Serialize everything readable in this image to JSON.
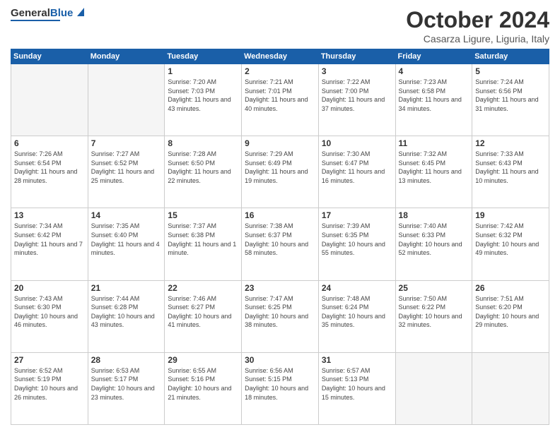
{
  "header": {
    "logo_general": "General",
    "logo_blue": "Blue",
    "month_title": "October 2024",
    "location": "Casarza Ligure, Liguria, Italy"
  },
  "days_of_week": [
    "Sunday",
    "Monday",
    "Tuesday",
    "Wednesday",
    "Thursday",
    "Friday",
    "Saturday"
  ],
  "weeks": [
    [
      {
        "day": "",
        "info": ""
      },
      {
        "day": "",
        "info": ""
      },
      {
        "day": "1",
        "info": "Sunrise: 7:20 AM\nSunset: 7:03 PM\nDaylight: 11 hours and 43 minutes."
      },
      {
        "day": "2",
        "info": "Sunrise: 7:21 AM\nSunset: 7:01 PM\nDaylight: 11 hours and 40 minutes."
      },
      {
        "day": "3",
        "info": "Sunrise: 7:22 AM\nSunset: 7:00 PM\nDaylight: 11 hours and 37 minutes."
      },
      {
        "day": "4",
        "info": "Sunrise: 7:23 AM\nSunset: 6:58 PM\nDaylight: 11 hours and 34 minutes."
      },
      {
        "day": "5",
        "info": "Sunrise: 7:24 AM\nSunset: 6:56 PM\nDaylight: 11 hours and 31 minutes."
      }
    ],
    [
      {
        "day": "6",
        "info": "Sunrise: 7:26 AM\nSunset: 6:54 PM\nDaylight: 11 hours and 28 minutes."
      },
      {
        "day": "7",
        "info": "Sunrise: 7:27 AM\nSunset: 6:52 PM\nDaylight: 11 hours and 25 minutes."
      },
      {
        "day": "8",
        "info": "Sunrise: 7:28 AM\nSunset: 6:50 PM\nDaylight: 11 hours and 22 minutes."
      },
      {
        "day": "9",
        "info": "Sunrise: 7:29 AM\nSunset: 6:49 PM\nDaylight: 11 hours and 19 minutes."
      },
      {
        "day": "10",
        "info": "Sunrise: 7:30 AM\nSunset: 6:47 PM\nDaylight: 11 hours and 16 minutes."
      },
      {
        "day": "11",
        "info": "Sunrise: 7:32 AM\nSunset: 6:45 PM\nDaylight: 11 hours and 13 minutes."
      },
      {
        "day": "12",
        "info": "Sunrise: 7:33 AM\nSunset: 6:43 PM\nDaylight: 11 hours and 10 minutes."
      }
    ],
    [
      {
        "day": "13",
        "info": "Sunrise: 7:34 AM\nSunset: 6:42 PM\nDaylight: 11 hours and 7 minutes."
      },
      {
        "day": "14",
        "info": "Sunrise: 7:35 AM\nSunset: 6:40 PM\nDaylight: 11 hours and 4 minutes."
      },
      {
        "day": "15",
        "info": "Sunrise: 7:37 AM\nSunset: 6:38 PM\nDaylight: 11 hours and 1 minute."
      },
      {
        "day": "16",
        "info": "Sunrise: 7:38 AM\nSunset: 6:37 PM\nDaylight: 10 hours and 58 minutes."
      },
      {
        "day": "17",
        "info": "Sunrise: 7:39 AM\nSunset: 6:35 PM\nDaylight: 10 hours and 55 minutes."
      },
      {
        "day": "18",
        "info": "Sunrise: 7:40 AM\nSunset: 6:33 PM\nDaylight: 10 hours and 52 minutes."
      },
      {
        "day": "19",
        "info": "Sunrise: 7:42 AM\nSunset: 6:32 PM\nDaylight: 10 hours and 49 minutes."
      }
    ],
    [
      {
        "day": "20",
        "info": "Sunrise: 7:43 AM\nSunset: 6:30 PM\nDaylight: 10 hours and 46 minutes."
      },
      {
        "day": "21",
        "info": "Sunrise: 7:44 AM\nSunset: 6:28 PM\nDaylight: 10 hours and 43 minutes."
      },
      {
        "day": "22",
        "info": "Sunrise: 7:46 AM\nSunset: 6:27 PM\nDaylight: 10 hours and 41 minutes."
      },
      {
        "day": "23",
        "info": "Sunrise: 7:47 AM\nSunset: 6:25 PM\nDaylight: 10 hours and 38 minutes."
      },
      {
        "day": "24",
        "info": "Sunrise: 7:48 AM\nSunset: 6:24 PM\nDaylight: 10 hours and 35 minutes."
      },
      {
        "day": "25",
        "info": "Sunrise: 7:50 AM\nSunset: 6:22 PM\nDaylight: 10 hours and 32 minutes."
      },
      {
        "day": "26",
        "info": "Sunrise: 7:51 AM\nSunset: 6:20 PM\nDaylight: 10 hours and 29 minutes."
      }
    ],
    [
      {
        "day": "27",
        "info": "Sunrise: 6:52 AM\nSunset: 5:19 PM\nDaylight: 10 hours and 26 minutes."
      },
      {
        "day": "28",
        "info": "Sunrise: 6:53 AM\nSunset: 5:17 PM\nDaylight: 10 hours and 23 minutes."
      },
      {
        "day": "29",
        "info": "Sunrise: 6:55 AM\nSunset: 5:16 PM\nDaylight: 10 hours and 21 minutes."
      },
      {
        "day": "30",
        "info": "Sunrise: 6:56 AM\nSunset: 5:15 PM\nDaylight: 10 hours and 18 minutes."
      },
      {
        "day": "31",
        "info": "Sunrise: 6:57 AM\nSunset: 5:13 PM\nDaylight: 10 hours and 15 minutes."
      },
      {
        "day": "",
        "info": ""
      },
      {
        "day": "",
        "info": ""
      }
    ]
  ]
}
